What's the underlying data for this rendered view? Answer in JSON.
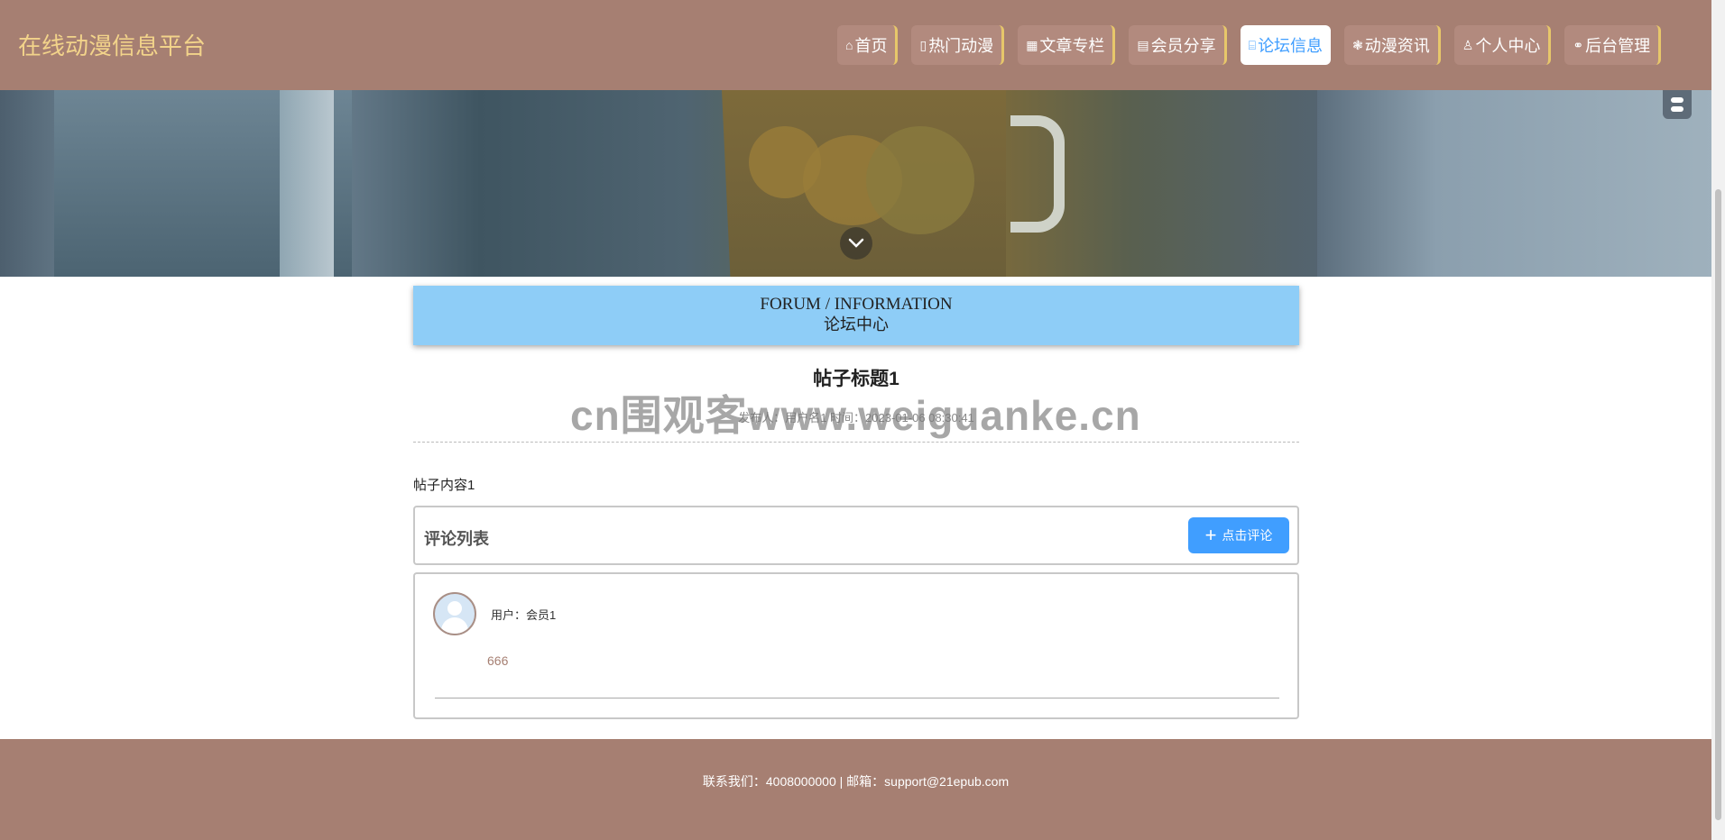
{
  "header": {
    "site_title": "在线动漫信息平台",
    "nav": [
      {
        "label": "首页",
        "icon": "home-icon",
        "glyph": "⌂",
        "active": false
      },
      {
        "label": "热门动漫",
        "icon": "phone-icon",
        "glyph": "▯",
        "active": false
      },
      {
        "label": "文章专栏",
        "icon": "grid-icon",
        "glyph": "▦",
        "active": false
      },
      {
        "label": "会员分享",
        "icon": "document-icon",
        "glyph": "▤",
        "active": false
      },
      {
        "label": "论坛信息",
        "icon": "forum-icon",
        "glyph": "⌸",
        "active": true
      },
      {
        "label": "动漫资讯",
        "icon": "flower-icon",
        "glyph": "❃",
        "active": false
      },
      {
        "label": "个人中心",
        "icon": "user-icon",
        "glyph": "♙",
        "active": false
      },
      {
        "label": "后台管理",
        "icon": "link-icon",
        "glyph": "⚭",
        "active": false
      }
    ]
  },
  "forum": {
    "title_en": "FORUM / INFORMATION",
    "title_cn": "论坛中心"
  },
  "post": {
    "title": "帖子标题1",
    "meta": "发布人：用户名1 时间：2023-01-06 08:30:41",
    "content": "帖子内容1"
  },
  "watermark": "cn围观客www.weiguanke.cn",
  "comments": {
    "header": "评论列表",
    "add_button": "点击评论",
    "items": [
      {
        "user": "用户：会员1",
        "text": "666"
      }
    ]
  },
  "footer": {
    "text": "联系我们：4008000000 | 邮箱：support@21epub.com"
  },
  "colors": {
    "header_bg": "#a67f72",
    "title_color": "#f2d38a",
    "accent": "#409eff",
    "forum_header_bg": "#8ecdf7"
  }
}
